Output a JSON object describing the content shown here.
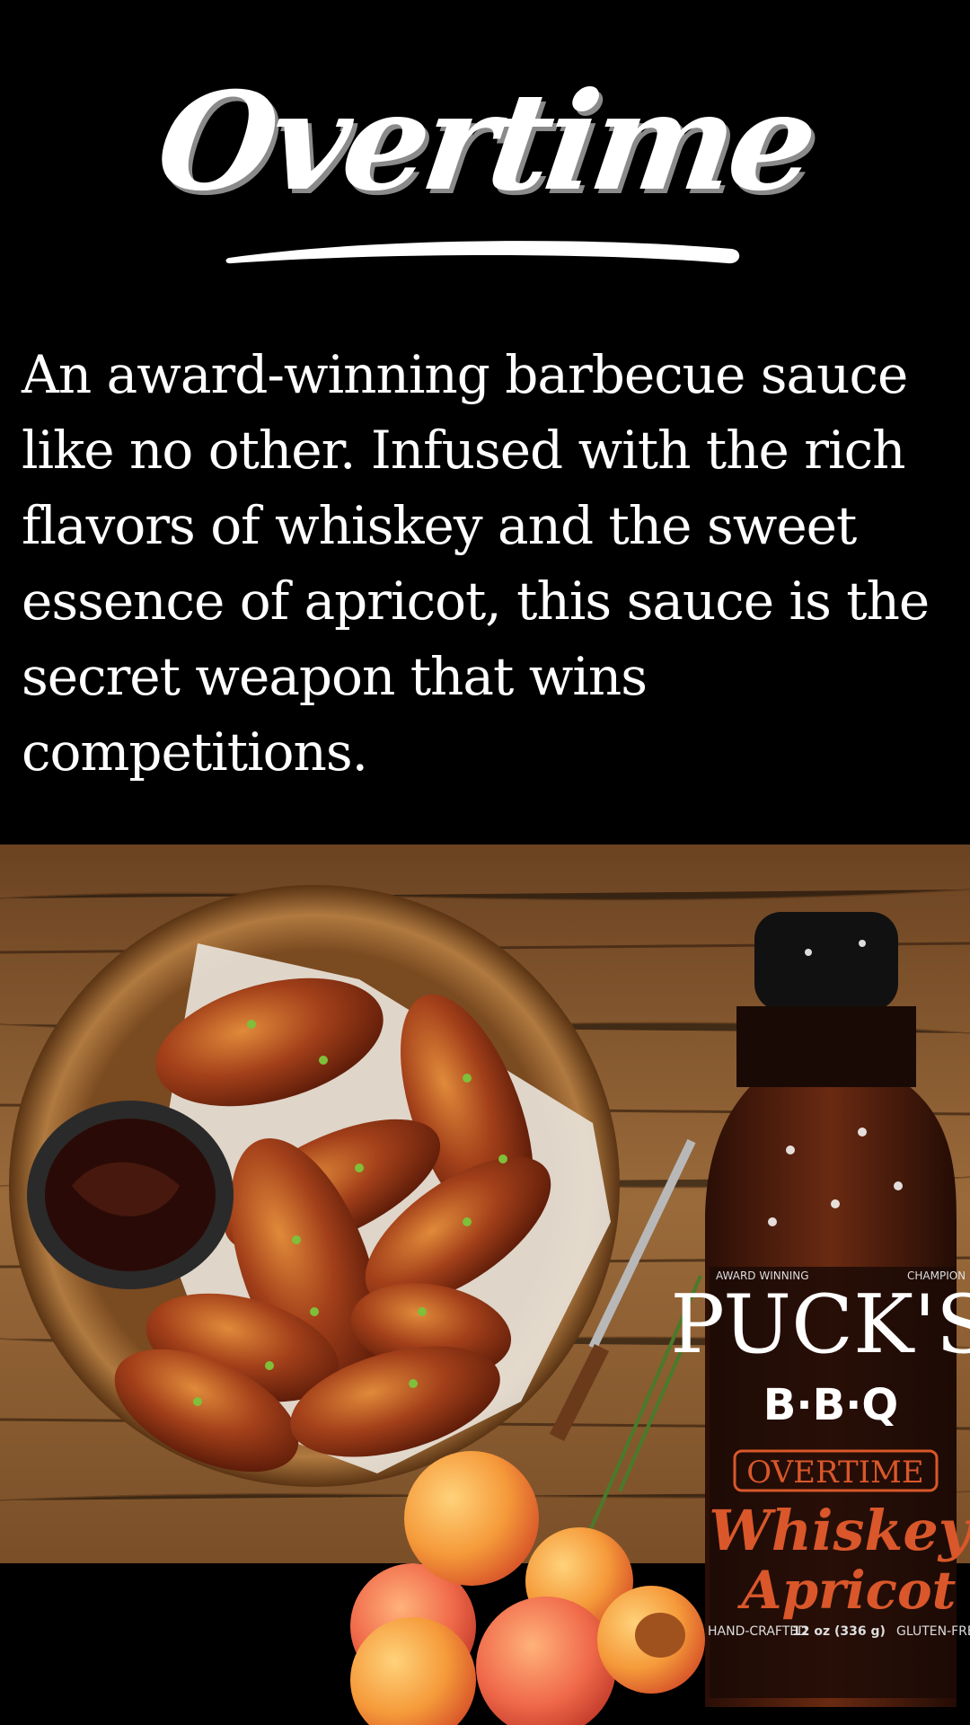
{
  "header": {
    "title": "Overtime"
  },
  "description": "An award-winning barbecue sauce like no other. Infused with the rich flavors of whiskey and the sweet essence of apricot, this sauce is the secret weapon that wins competitions.",
  "product_label": {
    "top_left": "AWARD WINNING",
    "top_right": "CHAMPION",
    "brand": "PUCK'S",
    "sub_brand": "B·B·Q",
    "line": "OVERTIME",
    "flavor_1": "Whiskey",
    "flavor_2": "Apricot",
    "footer_left": "HAND-CRAFTED",
    "footer_mid": "12 oz (336 g)",
    "footer_right": "GLUTEN-FREE"
  },
  "colors": {
    "background": "#000000",
    "text": "#ffffff",
    "label_accent": "#d9572a",
    "wood": "#8a5a2e"
  }
}
